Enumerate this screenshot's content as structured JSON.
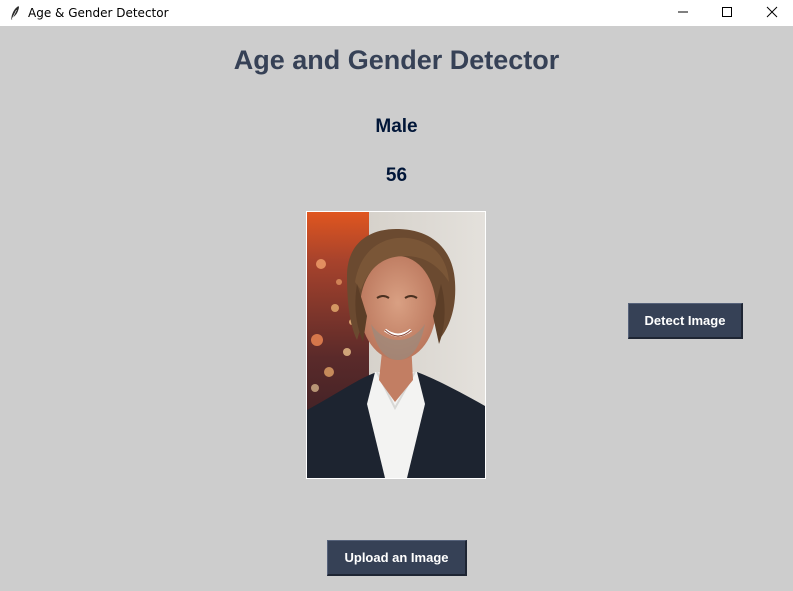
{
  "window": {
    "title": "Age & Gender Detector",
    "icon": "feather-icon",
    "controls": [
      "minimize-icon",
      "maximize-icon",
      "close-icon"
    ]
  },
  "app": {
    "heading": "Age and Gender Detector",
    "gender_result": "Male",
    "age_result": "56"
  },
  "buttons": {
    "detect_label": "Detect Image",
    "upload_label": "Upload an Image"
  },
  "colors": {
    "background": "#cdcdcd",
    "heading": "#364156",
    "result_text": "#011638",
    "button_bg": "#364156",
    "button_text": "#ffffff"
  }
}
